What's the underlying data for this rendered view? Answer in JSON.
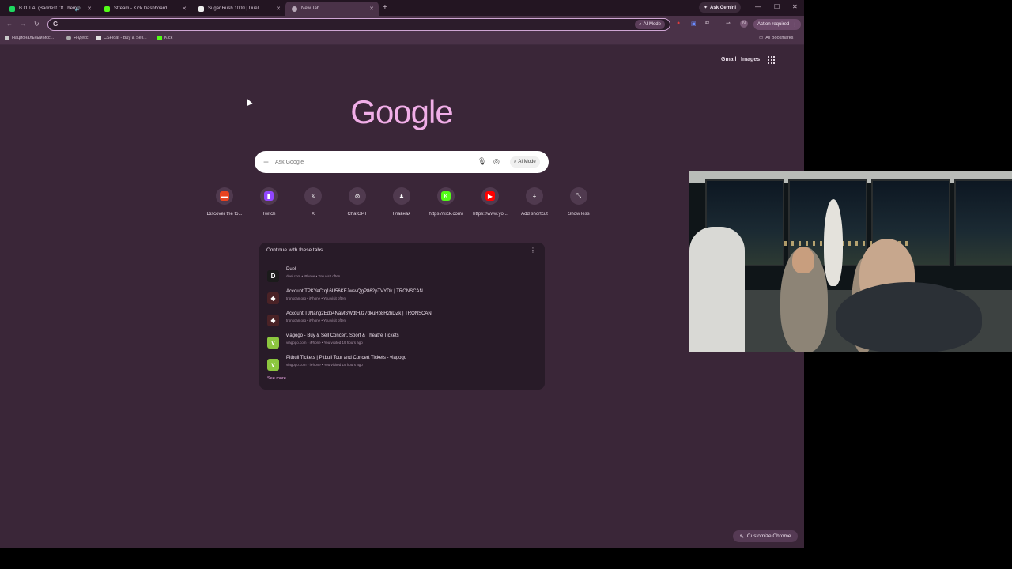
{
  "tabs": [
    {
      "title": "B.O.T.A. (Baddest Of Them",
      "favicon_color": "#1ed760",
      "active": false,
      "audio": true
    },
    {
      "title": "Stream - Kick Dashboard",
      "favicon_color": "#53fc18",
      "active": false,
      "audio": false
    },
    {
      "title": "Sugar Rush 1000 | Duel",
      "favicon_color": "#ffffff",
      "active": false,
      "audio": false
    },
    {
      "title": "New Tab",
      "favicon_color": "#b8a8b8",
      "active": true,
      "audio": false
    }
  ],
  "ask_gemini": "Ask Gemini",
  "omnibox": {
    "value": "",
    "g_letter": "G",
    "ai_mode": "AI Mode"
  },
  "action_required": "Action required",
  "bookmarks": [
    {
      "label": "Национальный исс...",
      "color": "#c9c9c9"
    },
    {
      "label": "Яндекс",
      "color": "#aaaaaa"
    },
    {
      "label": "CSFloat - Buy & Sell...",
      "color": "#e0e0e0"
    },
    {
      "label": "Kick",
      "color": "#53fc18"
    }
  ],
  "all_bookmarks": "All Bookmarks",
  "top_links": {
    "gmail": "Gmail",
    "images": "Images"
  },
  "logo": "Google",
  "search": {
    "placeholder": "Ask Google",
    "ai_mode": "AI Mode"
  },
  "shortcuts": [
    {
      "label": "Discover the to...",
      "icon": "discover-icon",
      "color": "#e8431f",
      "glyph": "▬"
    },
    {
      "label": "Twitch",
      "icon": "twitch-icon",
      "color": "#9146ff",
      "glyph": "▮"
    },
    {
      "label": "X",
      "icon": "x-icon",
      "color": "#503a4f",
      "glyph": "𝕏"
    },
    {
      "label": "ChatGPT",
      "icon": "chatgpt-icon",
      "color": "#503a4f",
      "glyph": "⊛"
    },
    {
      "label": "Главная",
      "icon": "chess-icon",
      "color": "#503a4f",
      "glyph": "♟"
    },
    {
      "label": "https://kick.com/",
      "icon": "kick-icon",
      "color": "#53fc18",
      "glyph": "K"
    },
    {
      "label": "https://www.yo...",
      "icon": "youtube-icon",
      "color": "#ff0000",
      "glyph": "▶"
    },
    {
      "label": "Add shortcut",
      "icon": "plus-icon",
      "color": "#503a4f",
      "glyph": "+"
    },
    {
      "label": "Show less",
      "icon": "collapse-icon",
      "color": "#503a4f",
      "glyph": "⤡"
    }
  ],
  "continue_card": {
    "title": "Continue with these tabs",
    "rows": [
      {
        "title": "Duel",
        "sub": "duel.com • iPhone • You visit often",
        "icon_text": "D",
        "icon_color": "#1b1b1b"
      },
      {
        "title": "Account TPKYeCtq16U56KEJwsvQgP862pTVYDk | TRONSCAN",
        "sub": "tronscan.org • iPhone • You visit often",
        "icon_text": "◆",
        "icon_color": "#4a2226"
      },
      {
        "title": "Account TJNang2Edp4NaMSWdtHJz7dkuHb8H2hDZk | TRONSCAN",
        "sub": "tronscan.org • iPhone • You visit often",
        "icon_text": "◆",
        "icon_color": "#4a2226"
      },
      {
        "title": "viagogo - Buy & Sell Concert, Sport & Theatre Tickets",
        "sub": "viagogo.com • iPhone • You visited 19 hours ago",
        "icon_text": "v",
        "icon_color": "#8cc63f"
      },
      {
        "title": "Pitbull Tickets | Pitbull Tour and Concert Tickets - viagogo",
        "sub": "viagogo.com • iPhone • You visited 19 hours ago",
        "icon_text": "v",
        "icon_color": "#8cc63f"
      }
    ],
    "see_more": "See more"
  },
  "customize": "Customize Chrome",
  "colors": {
    "page_bg": "#3a2638",
    "logo": "#f1aee8",
    "accent": "#e4a3df"
  }
}
